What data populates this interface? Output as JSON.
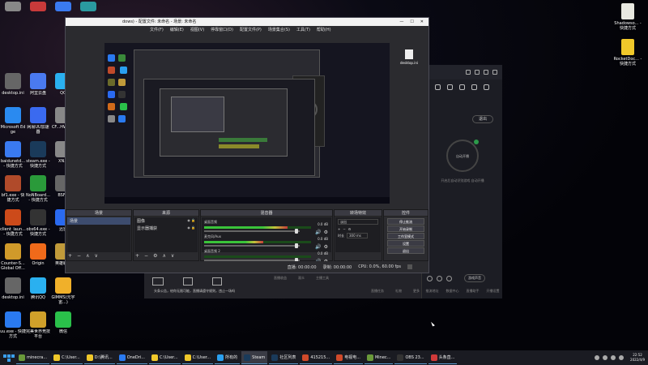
{
  "desktop": {
    "left_icons": [
      {
        "label": "desktop.ini",
        "color": "#666666"
      },
      {
        "label": "阿里云盘",
        "color": "#4a7af0"
      },
      {
        "label": "QQ",
        "color": "#2ab0f0"
      },
      {
        "label": "Microsoft Edge",
        "color": "#2a8af0"
      },
      {
        "label": "网易UU加速器",
        "color": "#3a6af0"
      },
      {
        "label": "CF...HWM...",
        "color": "#888888"
      },
      {
        "label": "baidunetd... - 快捷方式",
        "color": "#3a7af0"
      },
      {
        "label": "steam.exe - 快捷方式",
        "color": "#1a3a5a"
      },
      {
        "label": "XN...",
        "color": "#888888"
      },
      {
        "label": "bf1.exe - 快捷方式",
        "color": "#b04a2a"
      },
      {
        "label": "NoNBoard... - 快捷方式",
        "color": "#2a9a3a"
      },
      {
        "label": "BSF...",
        "color": "#666666"
      },
      {
        "label": "client_laun... - 快捷方式",
        "color": "#cc4a1a"
      },
      {
        "label": "obs64.exe - 快捷方式",
        "color": "#333333"
      },
      {
        "label": "迅雷",
        "color": "#2a6af0"
      },
      {
        "label": "Counter-S... Global Off...",
        "color": "#d09a2a"
      },
      {
        "label": "Origin",
        "color": "#f06a1a"
      },
      {
        "label": "英雄联盟",
        "color": "#c09a3a"
      },
      {
        "label": "desktop.ini",
        "color": "#666666"
      },
      {
        "label": "腾讯QQ",
        "color": "#2ab0f0"
      },
      {
        "label": "GIMMS(元宇宙...)",
        "color": "#f0b02a"
      },
      {
        "label": "uu.exe - 快捷方式",
        "color": "#2a7af0"
      },
      {
        "label": "完美世界竞技平台",
        "color": "#d0a02a"
      },
      {
        "label": "微信",
        "color": "#2ac04a"
      }
    ],
    "right_icons": [
      {
        "label": "Shadowso... - 快捷方式",
        "color": "#e8e8e0"
      },
      {
        "label": "RocketDoc... - 快捷方式",
        "color": "#f0c82a"
      }
    ]
  },
  "right_app": {
    "exit_label": "退出",
    "circle_label": "自动开播",
    "hint_text": "开启后自动识别游戏 自动开播",
    "bottom_pill": "游戏声音",
    "footer": [
      "推流地址",
      "数据中心",
      "直播助手",
      "开播设置"
    ]
  },
  "bg_panel": {
    "message": "头条公告，给你无限可能，直播请遵守规则，违止一场吗",
    "tabs_top": [
      "直播收益",
      "观众",
      "主播工具"
    ],
    "tabs_bottom": [
      "直播任务",
      "礼物",
      "更多",
      "设置"
    ]
  },
  "obs": {
    "title": "dows) - 配置文件: 未命名 - 场景: 未命名",
    "menu": [
      "文件(F)",
      "编辑(E)",
      "视图(V)",
      "停靠窗口(D)",
      "配置文件(P)",
      "场景集合(S)",
      "工具(T)",
      "帮助(H)"
    ],
    "preview_right_label": "desktop.ini",
    "docks": {
      "scenes": {
        "title": "场景",
        "items": [
          "场景"
        ]
      },
      "sources": {
        "title": "来源",
        "items": [
          "图像",
          "显示器捕获"
        ]
      },
      "mixer": {
        "title": "混音器",
        "channels": [
          {
            "name": "桌面音频",
            "db": "0.0 dB",
            "level": 0.78,
            "volume": 0.95
          },
          {
            "name": "麦克风/Aux",
            "db": "0.0 dB",
            "level": 0.55,
            "volume": 0.95
          },
          {
            "name": "桌面音频 2",
            "db": "0.0 dB",
            "level": 0.0,
            "volume": 0.95
          }
        ]
      },
      "transitions": {
        "title": "转场特效",
        "type": "淡出",
        "duration_label": "时长",
        "duration": "300 ms"
      },
      "controls": {
        "title": "控件",
        "buttons": [
          "停止推流",
          "开始录制",
          "工作室模式",
          "设置",
          "退出"
        ]
      }
    },
    "status": {
      "live": "直播: 00:00:00",
      "rec": "录制: 00:00:00",
      "cpu": "CPU: 0.0%, 60.00 fps"
    }
  },
  "taskbar": {
    "tasks": [
      {
        "label": "minecra...",
        "color": "#6a9a3a"
      },
      {
        "label": "C:\\User...",
        "color": "#f0c82a"
      },
      {
        "label": "D:\\腾讯...",
        "color": "#f0c82a"
      },
      {
        "label": "OneDri...",
        "color": "#2a7af0"
      },
      {
        "label": "C:\\User...",
        "color": "#f0c82a"
      },
      {
        "label": "C:\\User...",
        "color": "#f0c82a"
      },
      {
        "label": "所有的",
        "color": "#2aa0f0"
      },
      {
        "label": "Steam",
        "color": "#1a3a5a"
      },
      {
        "label": "社区列表",
        "color": "#1a3a5a"
      },
      {
        "label": "415215...",
        "color": "#d04a2a"
      },
      {
        "label": "电视电...",
        "color": "#d04a2a"
      },
      {
        "label": "Minec...",
        "color": "#6a9a3a"
      },
      {
        "label": "OBS 23...",
        "color": "#333333"
      },
      {
        "label": "头条直...",
        "color": "#d03a3a"
      }
    ],
    "time": "22:52",
    "date": "2022/4/9"
  }
}
